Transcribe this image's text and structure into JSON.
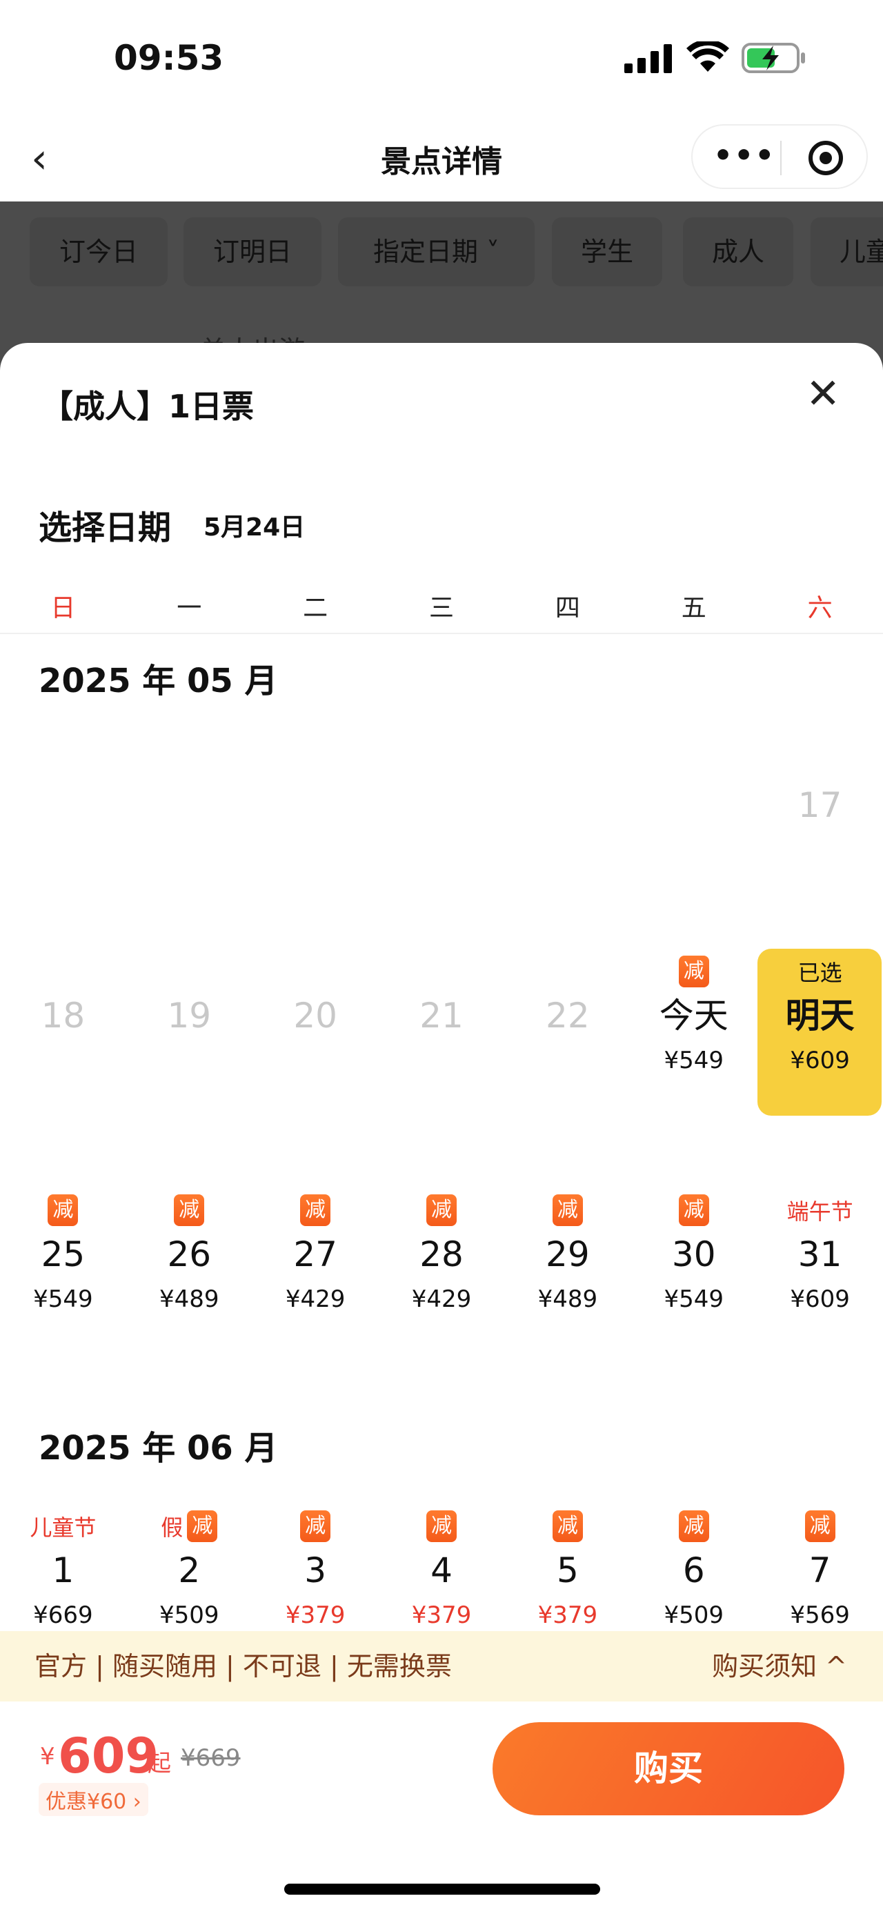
{
  "status": {
    "time": "09:53"
  },
  "nav": {
    "title": "景点详情",
    "back": "‹",
    "more": "•••"
  },
  "filters": [
    "订今日",
    "订明日",
    "指定日期 ˅",
    "学生",
    "成人",
    "儿童"
  ],
  "background_text": "单人出游",
  "sheet": {
    "title": "【成人】1日票",
    "close": "✕",
    "select_label": "选择日期",
    "selected_date": "5月24日"
  },
  "weekdays": [
    "日",
    "一",
    "二",
    "三",
    "四",
    "五",
    "六"
  ],
  "months": [
    {
      "label": "2025 年 05 月",
      "rows": [
        [
          null,
          null,
          null,
          null,
          null,
          null,
          {
            "day": "17",
            "disabled": true
          }
        ],
        [
          {
            "day": "18",
            "disabled": true
          },
          {
            "day": "19",
            "disabled": true
          },
          {
            "day": "20",
            "disabled": true
          },
          {
            "day": "21",
            "disabled": true
          },
          {
            "day": "22",
            "disabled": true
          },
          {
            "day": "今天",
            "price": "¥549",
            "badge": "减"
          },
          {
            "day": "明天",
            "price": "¥609",
            "top": "已选",
            "selected": true
          }
        ],
        [
          {
            "day": "25",
            "price": "¥549",
            "badge": "减"
          },
          {
            "day": "26",
            "price": "¥489",
            "badge": "减"
          },
          {
            "day": "27",
            "price": "¥429",
            "badge": "减"
          },
          {
            "day": "28",
            "price": "¥429",
            "badge": "减"
          },
          {
            "day": "29",
            "price": "¥489",
            "badge": "减"
          },
          {
            "day": "30",
            "price": "¥549",
            "badge": "减"
          },
          {
            "day": "31",
            "price": "¥609",
            "holiday": "端午节"
          }
        ]
      ]
    },
    {
      "label": "2025 年 06 月",
      "rows": [
        [
          {
            "day": "1",
            "price": "¥669",
            "holiday": "儿童节"
          },
          {
            "day": "2",
            "price": "¥509",
            "holiday": "假",
            "badge": "减"
          },
          {
            "day": "3",
            "price": "¥379",
            "badge": "减",
            "red": true
          },
          {
            "day": "4",
            "price": "¥379",
            "badge": "减",
            "red": true
          },
          {
            "day": "5",
            "price": "¥379",
            "badge": "减",
            "red": true
          },
          {
            "day": "6",
            "price": "¥509",
            "badge": "减"
          },
          {
            "day": "7",
            "price": "¥569",
            "badge": "减"
          }
        ]
      ]
    }
  ],
  "notice": {
    "tags": "官方 | 随买随用 | 不可退 | 无需换票",
    "link": "购买须知 ^"
  },
  "footer": {
    "currency": "¥",
    "price": "609",
    "suffix": "起",
    "original": "¥669",
    "discount": "优惠¥60 ›",
    "buy": "购买"
  }
}
